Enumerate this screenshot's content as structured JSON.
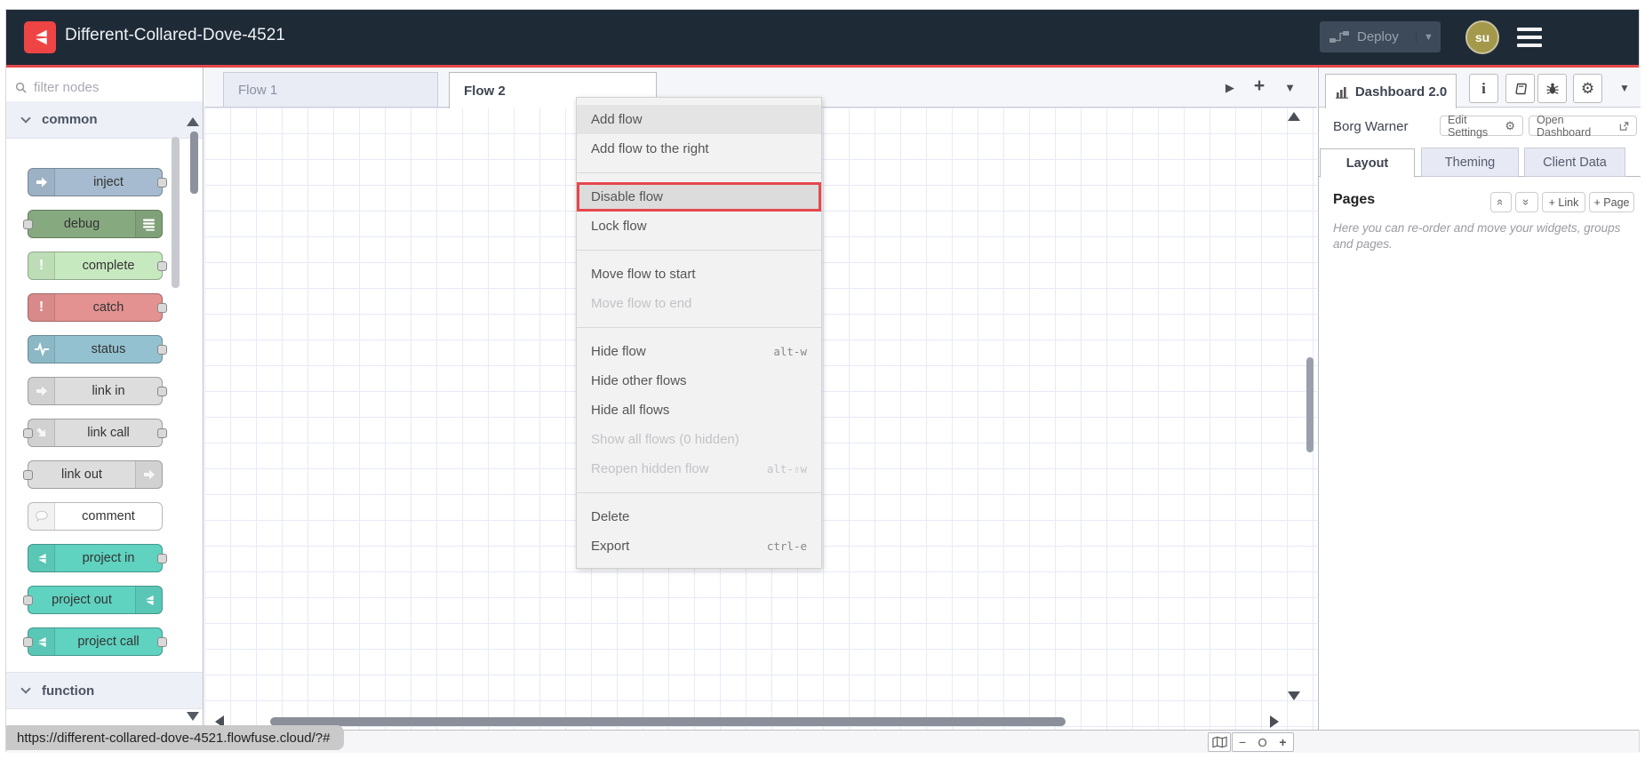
{
  "header": {
    "title": "Different-Collared-Dove-4521",
    "deploy_label": "Deploy",
    "avatar_initials": "su"
  },
  "palette": {
    "filter_placeholder": "filter nodes",
    "section_common": "common",
    "section_function": "function",
    "nodes": [
      {
        "label": "inject",
        "color": "#a6bbcf"
      },
      {
        "label": "debug",
        "color": "#87a980"
      },
      {
        "label": "complete",
        "color": "#c7e9c0"
      },
      {
        "label": "catch",
        "color": "#e49191"
      },
      {
        "label": "status",
        "color": "#94c1d0"
      },
      {
        "label": "link in",
        "color": "#dddddd"
      },
      {
        "label": "link call",
        "color": "#dddddd"
      },
      {
        "label": "link out",
        "color": "#dddddd"
      },
      {
        "label": "comment",
        "color": "#ffffff"
      },
      {
        "label": "project in",
        "color": "#5fd2c0"
      },
      {
        "label": "project out",
        "color": "#5fd2c0"
      },
      {
        "label": "project call",
        "color": "#5fd2c0"
      }
    ]
  },
  "canvas": {
    "tabs": [
      {
        "label": "Flow 1",
        "active": false
      },
      {
        "label": "Flow 2",
        "active": true
      }
    ]
  },
  "context_menu": {
    "highlight_color": "#e5484d",
    "items": [
      {
        "label": "Add flow"
      },
      {
        "label": "Add flow to the right"
      },
      {
        "label": "Disable flow",
        "highlighted": true
      },
      {
        "label": "Lock flow"
      },
      {
        "label": "Move flow to start"
      },
      {
        "label": "Move flow to end",
        "disabled": true
      },
      {
        "label": "Hide flow",
        "shortcut": "alt-w"
      },
      {
        "label": "Hide other flows"
      },
      {
        "label": "Hide all flows"
      },
      {
        "label": "Show all flows (0 hidden)",
        "disabled": true
      },
      {
        "label": "Reopen hidden flow",
        "shortcut": "alt-⇧w",
        "disabled": true
      },
      {
        "label": "Delete"
      },
      {
        "label": "Export",
        "shortcut": "ctrl-e"
      }
    ]
  },
  "sidebar": {
    "tab_label": "Dashboard 2.0",
    "project_name": "Borg Warner",
    "edit_settings_label": "Edit Settings",
    "open_dashboard_label": "Open Dashboard",
    "tabs": [
      {
        "label": "Layout",
        "active": true
      },
      {
        "label": "Theming",
        "active": false
      },
      {
        "label": "Client Data",
        "active": false
      }
    ],
    "pages_title": "Pages",
    "add_link_label": "+ Link",
    "add_page_label": "+ Page",
    "help_text": "Here you can re-order and move your widgets, groups and pages."
  },
  "statusbar": {
    "url": "https://different-collared-dove-4521.flowfuse.cloud/?#"
  },
  "colors": {
    "header_bg": "#1f2a37",
    "accent_red": "#e5484d",
    "brand_red": "#ee4444",
    "avatar_bg": "#a4984b",
    "project_teal": "#5fd2c0"
  }
}
